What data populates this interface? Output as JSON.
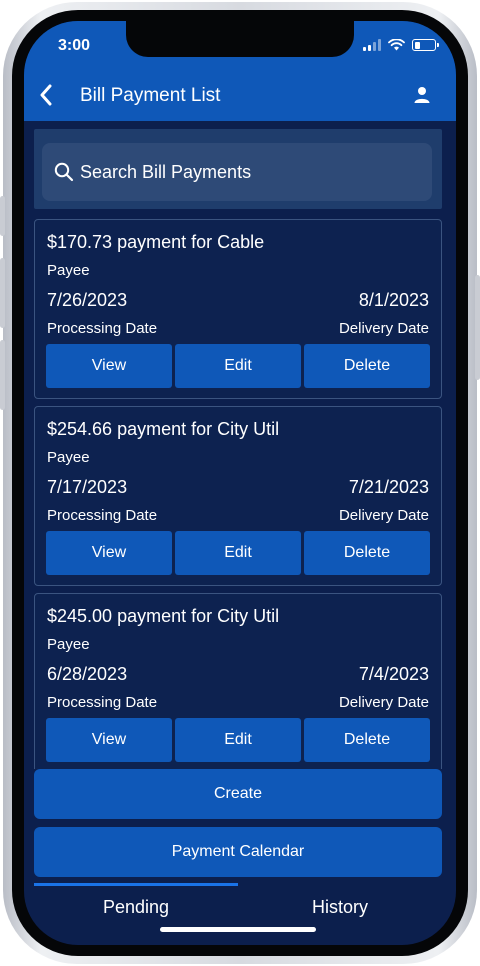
{
  "status_bar": {
    "time": "3:00"
  },
  "header": {
    "title": "Bill Payment List"
  },
  "search": {
    "placeholder": "Search Bill Payments"
  },
  "payments": [
    {
      "title": "$170.73 payment for Cable",
      "payee_label": "Payee",
      "processing_date": "7/26/2023",
      "delivery_date": "8/1/2023",
      "processing_label": "Processing Date",
      "delivery_label": "Delivery Date",
      "view_label": "View",
      "edit_label": "Edit",
      "delete_label": "Delete"
    },
    {
      "title": "$254.66 payment for City Util",
      "payee_label": "Payee",
      "processing_date": "7/17/2023",
      "delivery_date": "7/21/2023",
      "processing_label": "Processing Date",
      "delivery_label": "Delivery Date",
      "view_label": "View",
      "edit_label": "Edit",
      "delete_label": "Delete"
    },
    {
      "title": "$245.00 payment for City Util",
      "payee_label": "Payee",
      "processing_date": "6/28/2023",
      "delivery_date": "7/4/2023",
      "processing_label": "Processing Date",
      "delivery_label": "Delivery Date",
      "view_label": "View",
      "edit_label": "Edit",
      "delete_label": "Delete"
    }
  ],
  "buttons": {
    "create": "Create",
    "payment_calendar": "Payment Calendar"
  },
  "tabs": [
    {
      "label": "Pending",
      "active": true
    },
    {
      "label": "History",
      "active": false
    }
  ],
  "icons": {
    "back": "chevron-left-icon",
    "profile": "user-icon",
    "search": "search-icon",
    "signal": "signal-icon",
    "wifi": "wifi-icon",
    "battery": "battery-icon"
  },
  "colors": {
    "primary": "#0f58b8",
    "background": "#0c1f4d",
    "card_border": "#3b5480",
    "search_field": "#2e4a77",
    "tab_indicator": "#1a73e8"
  }
}
